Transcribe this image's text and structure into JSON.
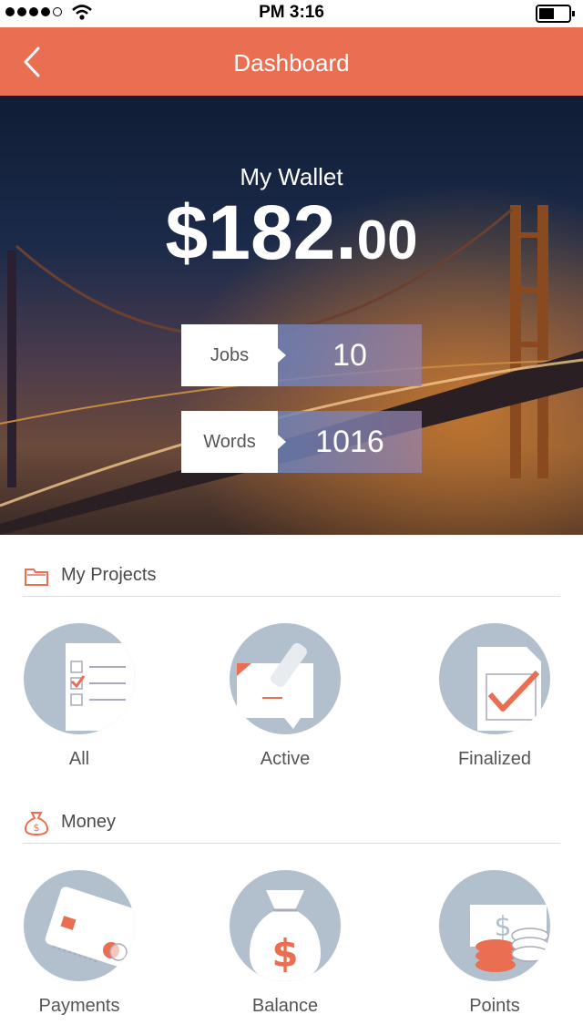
{
  "status_bar": {
    "time": "PM 3:16"
  },
  "nav": {
    "title": "Dashboard"
  },
  "wallet": {
    "label": "My Wallet",
    "amount_main": "$182.",
    "amount_cents": "00"
  },
  "stats": [
    {
      "label": "Jobs",
      "value": "10"
    },
    {
      "label": "Words",
      "value": "1016"
    }
  ],
  "projects": {
    "title": "My Projects",
    "items": [
      {
        "label": "All"
      },
      {
        "label": "Active"
      },
      {
        "label": "Finalized"
      }
    ]
  },
  "money": {
    "title": "Money",
    "items": [
      {
        "label": "Payments"
      },
      {
        "label": "Balance"
      },
      {
        "label": "Points"
      }
    ]
  },
  "colors": {
    "accent": "#ea6e52",
    "icon_circle": "#b2bfcd"
  }
}
